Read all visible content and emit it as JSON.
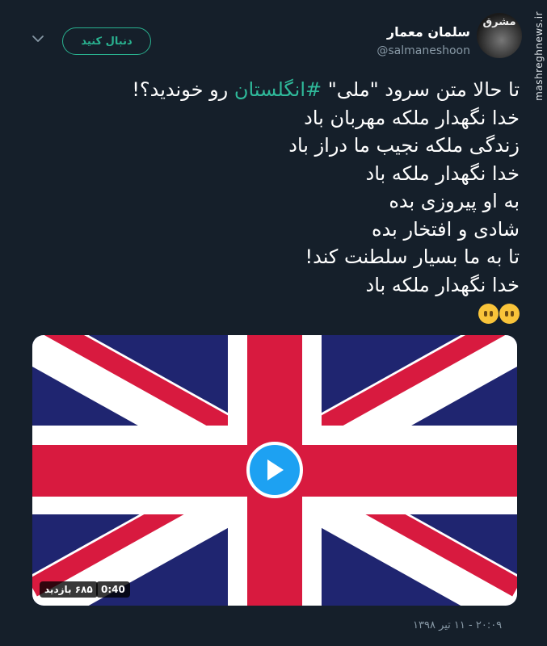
{
  "watermark": "mashreghnews.ir",
  "author": {
    "avatar_logo": "مشرق",
    "display_name": "سلمان معمار",
    "handle": "@salmaneshoon"
  },
  "follow_button": {
    "label": "دنبال کنید"
  },
  "tweet": {
    "line1_prefix": "تا حالا متن سرود \"ملی\" ",
    "hashtag": "#انگلستان",
    "line1_suffix": " رو خوندید؟!",
    "lines": [
      "خدا نگهدار ملکه مهربان باد",
      "زندگی ملکه نجیب ما دراز باد",
      "خدا نگهدار ملکه باد",
      "به او پیروزی بده",
      "شادی و افتخار بده",
      "تا به ما بسیار سلطنت کند!",
      "خدا نگهدار ملکه باد"
    ],
    "emojis": [
      "face-without-mouth-icon",
      "face-without-mouth-icon"
    ]
  },
  "video": {
    "views": "۶۸۵ بازدید",
    "duration": "0:40",
    "colors": {
      "blue": "#1f2570",
      "red": "#d81a3f",
      "white": "#ffffff"
    }
  },
  "timestamp": "۲۰:۰۹ - ۱۱ تیر ۱۳۹۸",
  "colors": {
    "accent": "#29b18f",
    "background": "#151f2a",
    "secondary_text": "#8899a6",
    "play": "#1da1f2"
  }
}
